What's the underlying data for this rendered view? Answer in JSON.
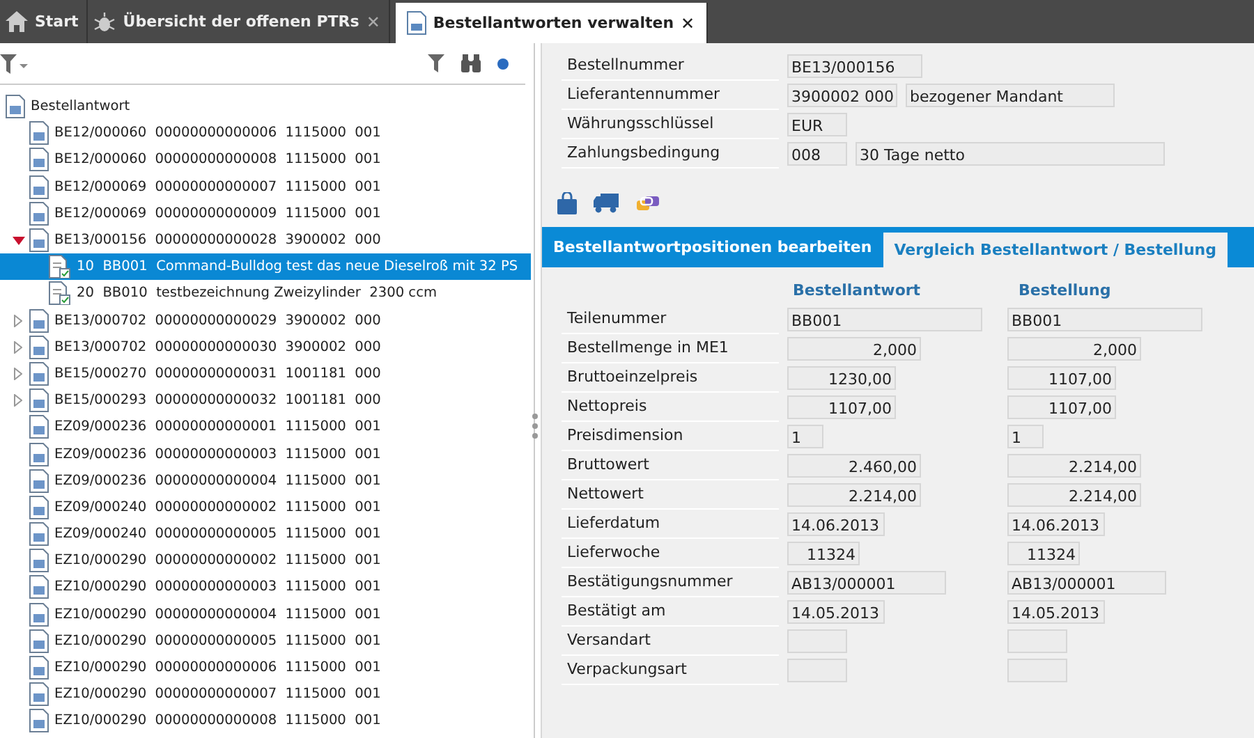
{
  "tabs": [
    {
      "label": "Start",
      "selected": false
    },
    {
      "label": "Übersicht der offenen PTRs",
      "close": "✕",
      "selected": false
    },
    {
      "label": "Bestellantworten verwalten",
      "close": "✕",
      "selected": true
    }
  ],
  "tree": {
    "label": "Bestellantwort",
    "items": [
      {
        "label": "BE12/000060  00000000000006  1115000  001",
        "kind": "leaf"
      },
      {
        "label": "BE12/000060  00000000000008  1115000  001",
        "kind": "leaf"
      },
      {
        "label": "BE12/000069  00000000000007  1115000  001",
        "kind": "leaf"
      },
      {
        "label": "BE12/000069  00000000000009  1115000  001",
        "kind": "leaf"
      },
      {
        "label": "BE13/000156  00000000000028  3900002  000",
        "kind": "branch",
        "expanded": true,
        "children": [
          {
            "label": "10  BB001  Command-Bulldog test das neue Dieselroß mit 32 PS",
            "selected": true
          },
          {
            "label": "20  BB010  testbezeichnung Zweizylinder  2300 ccm",
            "selected": false
          }
        ]
      },
      {
        "label": "BE13/000702  00000000000029  3900002  000",
        "kind": "branch",
        "expanded": false
      },
      {
        "label": "BE13/000702  00000000000030  3900002  000",
        "kind": "branch",
        "expanded": false
      },
      {
        "label": "BE15/000270  00000000000031  1001181  000",
        "kind": "branch",
        "expanded": false
      },
      {
        "label": "BE15/000293  00000000000032  1001181  000",
        "kind": "branch",
        "expanded": false
      },
      {
        "label": "EZ09/000236  00000000000001  1115000  001",
        "kind": "leaf"
      },
      {
        "label": "EZ09/000236  00000000000003  1115000  001",
        "kind": "leaf"
      },
      {
        "label": "EZ09/000236  00000000000004  1115000  001",
        "kind": "leaf"
      },
      {
        "label": "EZ09/000240  00000000000002  1115000  001",
        "kind": "leaf"
      },
      {
        "label": "EZ09/000240  00000000000005  1115000  001",
        "kind": "leaf"
      },
      {
        "label": "EZ10/000290  00000000000002  1115000  001",
        "kind": "leaf"
      },
      {
        "label": "EZ10/000290  00000000000003  1115000  001",
        "kind": "leaf"
      },
      {
        "label": "EZ10/000290  00000000000004  1115000  001",
        "kind": "leaf"
      },
      {
        "label": "EZ10/000290  00000000000005  1115000  001",
        "kind": "leaf"
      },
      {
        "label": "EZ10/000290  00000000000006  1115000  001",
        "kind": "leaf"
      },
      {
        "label": "EZ10/000290  00000000000007  1115000  001",
        "kind": "leaf"
      },
      {
        "label": "EZ10/000290  00000000000008  1115000  001",
        "kind": "leaf"
      }
    ]
  },
  "header_fields": [
    {
      "label": "Bestellnummer",
      "value": "BE13/000156"
    },
    {
      "label": "Lieferantennummer",
      "value": "3900002 000",
      "extra": "bezogener Mandant"
    },
    {
      "label": "Währungsschlüssel",
      "value": "EUR"
    },
    {
      "label": "Zahlungsbedingung",
      "value": "008",
      "extra": "30 Tage netto"
    }
  ],
  "section_tabs": [
    {
      "label": "Bestellantwortpositionen bearbeiten",
      "selected": false
    },
    {
      "label": "Vergleich Bestellantwort / Bestellung",
      "selected": true
    }
  ],
  "compare": {
    "columns": [
      "Bestellantwort",
      "Bestellung"
    ],
    "rows": [
      {
        "label": "Teilenummer",
        "kind": "text",
        "bestellantwort": "BB001",
        "bestellung": "BB001"
      },
      {
        "label": "Bestellmenge in ME1",
        "kind": "number",
        "bestellantwort": "2,000",
        "bestellung": "2,000"
      },
      {
        "label": "Bruttoeinzelpreis",
        "kind": "number",
        "bestellantwort": "1230,00",
        "bestellung": "1107,00"
      },
      {
        "label": "Nettopreis",
        "kind": "number",
        "bestellantwort": "1107,00",
        "bestellung": "1107,00"
      },
      {
        "label": "Preisdimension",
        "kind": "text",
        "bestellantwort": "1",
        "bestellung": "1"
      },
      {
        "label": "Bruttowert",
        "kind": "number",
        "bestellantwort": "2.460,00",
        "bestellung": "2.214,00"
      },
      {
        "label": "Nettowert",
        "kind": "number",
        "bestellantwort": "2.214,00",
        "bestellung": "2.214,00"
      },
      {
        "label": "Lieferdatum",
        "kind": "text",
        "bestellantwort": "14.06.2013",
        "bestellung": "14.06.2013"
      },
      {
        "label": "Lieferwoche",
        "kind": "number",
        "bestellantwort": "11324",
        "bestellung": "11324"
      },
      {
        "label": "Bestätigungsnummer",
        "kind": "text",
        "bestellantwort": "AB13/000001",
        "bestellung": "AB13/000001"
      },
      {
        "label": "Bestätigt am",
        "kind": "text",
        "bestellantwort": "14.05.2013",
        "bestellung": "14.05.2013"
      },
      {
        "label": "Versandart",
        "kind": "text"
      },
      {
        "label": "Verpackungsart",
        "kind": "text"
      }
    ]
  }
}
